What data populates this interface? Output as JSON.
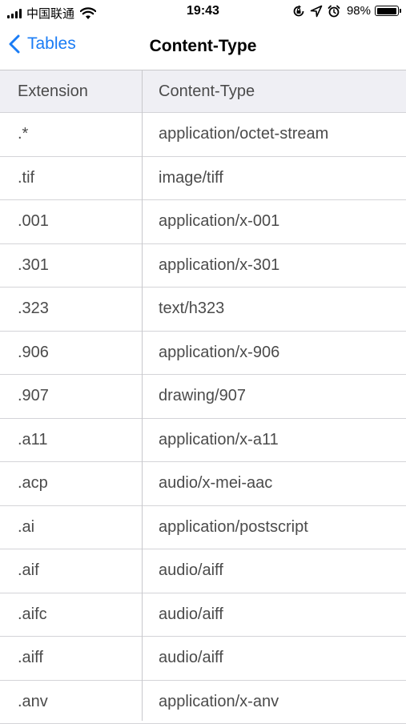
{
  "status": {
    "carrier": "中国联通",
    "time": "19:43",
    "battery": "98%",
    "battery_level": 0.98
  },
  "nav": {
    "back_label": "Tables",
    "title": "Content-Type"
  },
  "table": {
    "headers": [
      "Extension",
      "Content-Type"
    ],
    "rows": [
      {
        "ext": ".*",
        "type": "application/octet-stream"
      },
      {
        "ext": ".tif",
        "type": "image/tiff"
      },
      {
        "ext": ".001",
        "type": "application/x-001"
      },
      {
        "ext": ".301",
        "type": "application/x-301"
      },
      {
        "ext": ".323",
        "type": "text/h323"
      },
      {
        "ext": ".906",
        "type": "application/x-906"
      },
      {
        "ext": ".907",
        "type": "drawing/907"
      },
      {
        "ext": ".a11",
        "type": "application/x-a11"
      },
      {
        "ext": ".acp",
        "type": "audio/x-mei-aac"
      },
      {
        "ext": ".ai",
        "type": "application/postscript"
      },
      {
        "ext": ".aif",
        "type": "audio/aiff"
      },
      {
        "ext": ".aifc",
        "type": "audio/aiff"
      },
      {
        "ext": ".aiff",
        "type": "audio/aiff"
      },
      {
        "ext": ".anv",
        "type": "application/x-anv"
      }
    ]
  },
  "colors": {
    "accent": "#1a7cf5",
    "header_bg": "#efeff4",
    "separator": "#d4d4d8",
    "cell_text": "#4b4b4b"
  }
}
